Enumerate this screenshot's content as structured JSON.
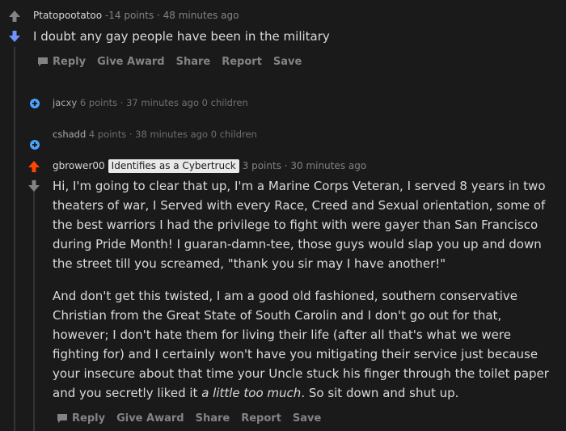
{
  "comments": [
    {
      "username": "Ptatopootatoo",
      "points": "-14 points",
      "time": "48 minutes ago",
      "body": "I doubt any gay people have been in the military",
      "actions": {
        "reply": "Reply",
        "give_award": "Give Award",
        "share": "Share",
        "report": "Report",
        "save": "Save"
      },
      "vote_state": "downvoted"
    },
    {
      "username": "jacxy",
      "points": "6 points",
      "time": "37 minutes ago",
      "children": "0 children",
      "collapsed": true
    },
    {
      "username": "cshadd",
      "points": "4 points",
      "time": "38 minutes ago",
      "children": "0 children",
      "collapsed": true
    },
    {
      "username": "gbrower00",
      "flair": "Identifies as a Cybertruck",
      "points": "3 points",
      "time": "30 minutes ago",
      "vote_state": "upvoted",
      "paragraph1": "Hi, I'm going to clear that up, I'm a Marine Corps Veteran, I served 8 years in two theaters of war, I Served with every Race, Creed and Sexual orientation, some of the best warriors I had the privilege to fight with were gayer than San Francisco during Pride Month! I guaran-damn-tee, those guys would slap you up and down the street till you screamed, \"thank you sir may I have another!\"",
      "paragraph2_start": "And don't get this twisted, I am a good old fashioned, southern conservative Christian from the Great State of South Carolin and I don't go out for that, however; I don't hate them for living their life (after all that's what we were fighting for) and I certainly won't have you mitigating their service just because your insecure about that time your Uncle stuck his finger through the toilet paper and you secretly liked it ",
      "paragraph2_italic": "a little too much",
      "paragraph2_end": ". So sit down and shut up.",
      "actions": {
        "reply": "Reply",
        "give_award": "Give Award",
        "share": "Share",
        "report": "Report",
        "save": "Save"
      }
    }
  ],
  "colors": {
    "upvote_active": "#ff4500",
    "downvote_active": "#7193ff",
    "expand": "#4aa3ff"
  }
}
